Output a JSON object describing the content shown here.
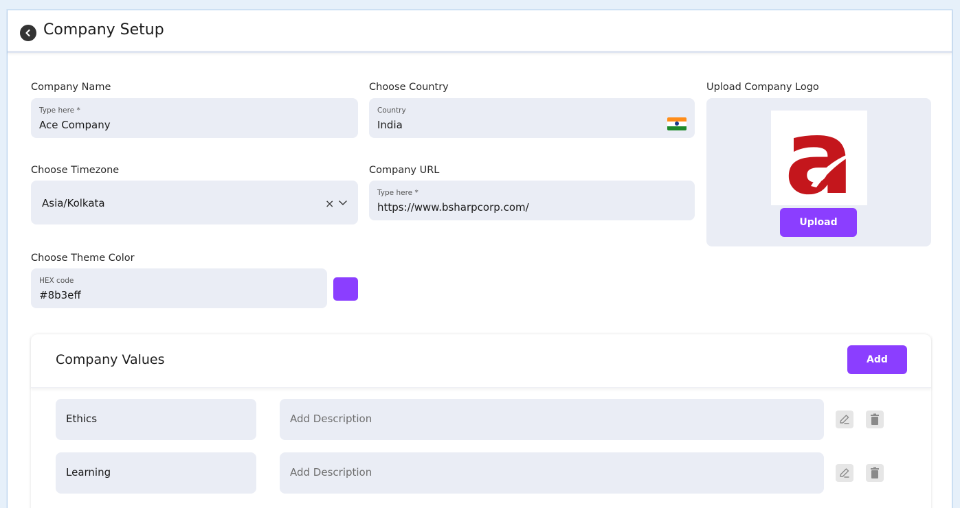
{
  "header": {
    "title": "Company Setup"
  },
  "company_name": {
    "label": "Company Name",
    "hint": "Type here *",
    "value": "Ace Company"
  },
  "country": {
    "label": "Choose Country",
    "hint": "Country",
    "value": "India"
  },
  "logo": {
    "label": "Upload Company Logo",
    "upload_label": "Upload",
    "logo_letter": "a",
    "logo_color": "#c4161c"
  },
  "timezone": {
    "label": "Choose Timezone",
    "value": "Asia/Kolkata",
    "clear_symbol": "×"
  },
  "company_url": {
    "label": "Company URL",
    "hint": "Type here *",
    "value": "https://www.bsharpcorp.com/"
  },
  "theme": {
    "label": "Choose Theme Color",
    "hint": "HEX code",
    "value": "#8b3eff"
  },
  "values_section": {
    "title": "Company Values",
    "add_label": "Add",
    "items": [
      {
        "name": "Ethics",
        "description_placeholder": "Add Description"
      },
      {
        "name": "Learning",
        "description_placeholder": "Add Description"
      }
    ]
  },
  "colors": {
    "accent": "#8b3eff",
    "field_bg": "#eaedf5"
  }
}
